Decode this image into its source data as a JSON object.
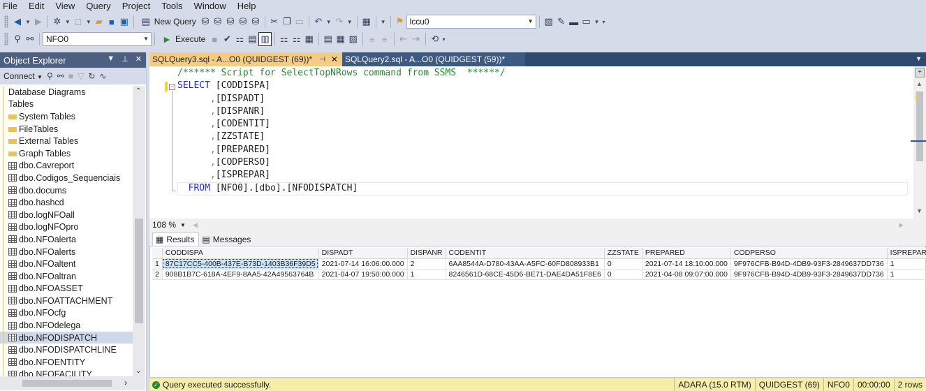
{
  "menu": [
    "File",
    "Edit",
    "View",
    "Query",
    "Project",
    "Tools",
    "Window",
    "Help"
  ],
  "toolbar": {
    "new_query": "New Query",
    "database_combo": "lccu0",
    "execute": "Execute",
    "current_db": "NFO0"
  },
  "object_explorer": {
    "title": "Object Explorer",
    "connect": "Connect",
    "items": [
      {
        "label": "Database Diagrams",
        "icon": "none"
      },
      {
        "label": "Tables",
        "icon": "none"
      },
      {
        "label": "System Tables",
        "icon": "folder"
      },
      {
        "label": "FileTables",
        "icon": "folder"
      },
      {
        "label": "External Tables",
        "icon": "folder"
      },
      {
        "label": "Graph Tables",
        "icon": "folder"
      },
      {
        "label": "dbo.Cavreport",
        "icon": "table"
      },
      {
        "label": "dbo.Codigos_Sequenciais",
        "icon": "table"
      },
      {
        "label": "dbo.docums",
        "icon": "table"
      },
      {
        "label": "dbo.hashcd",
        "icon": "table"
      },
      {
        "label": "dbo.logNFOall",
        "icon": "table"
      },
      {
        "label": "dbo.logNFOpro",
        "icon": "table"
      },
      {
        "label": "dbo.NFOalerta",
        "icon": "table"
      },
      {
        "label": "dbo.NFOalerts",
        "icon": "table"
      },
      {
        "label": "dbo.NFOaltent",
        "icon": "table"
      },
      {
        "label": "dbo.NFOaltran",
        "icon": "table"
      },
      {
        "label": "dbo.NFOASSET",
        "icon": "table"
      },
      {
        "label": "dbo.NFOATTACHMENT",
        "icon": "table"
      },
      {
        "label": "dbo.NFOcfg",
        "icon": "table"
      },
      {
        "label": "dbo.NFOdelega",
        "icon": "table"
      },
      {
        "label": "dbo.NFODISPATCH",
        "icon": "table",
        "selected": true
      },
      {
        "label": "dbo.NFODISPATCHLINE",
        "icon": "table"
      },
      {
        "label": "dbo.NFOENTITY",
        "icon": "table"
      },
      {
        "label": "dbo.NFOFACILITY",
        "icon": "table"
      }
    ]
  },
  "tabs": {
    "active": "SQLQuery3.sql - A...O0 (QUIDGEST (69))*",
    "inactive": "SQLQuery2.sql - A...O0 (QUIDGEST (59))*"
  },
  "editor": {
    "comment": "/****** Script for SelectTopNRows command from SSMS  ******/",
    "select_kw": "SELECT",
    "first_col": "[CODDISPA]",
    "columns": [
      "[DISPADT]",
      "[DISPANR]",
      "[CODENTIT]",
      "[ZZSTATE]",
      "[PREPARED]",
      "[CODPERSO]",
      "[ISPREPAR]"
    ],
    "from_kw": "FROM",
    "from_target": "[NFO0].[dbo].[NFODISPATCH]"
  },
  "zoom": "108 %",
  "results_tabs": {
    "results": "Results",
    "messages": "Messages"
  },
  "grid": {
    "headers": [
      "CODDISPA",
      "DISPADT",
      "DISPANR",
      "CODENTIT",
      "ZZSTATE",
      "PREPARED",
      "CODPERSO",
      "ISPREPAR"
    ],
    "rows": [
      {
        "n": "1",
        "cells": [
          "87C17CC5-400B-437E-B73D-1403B36F39D5",
          "2021-07-14 16:06:00.000",
          "2",
          "6AA8544A-D780-43AA-A5FC-60FD808933B1",
          "0",
          "2021-07-14 18:10:00.000",
          "9F976CFB-B94D-4DB9-93F3-2849637DD736",
          "1"
        ]
      },
      {
        "n": "2",
        "cells": [
          "908B1B7C-618A-4EF9-8AA5-42A49563764B",
          "2021-04-07 19:50:00.000",
          "1",
          "8246561D-68CE-45D6-BE71-DAE4DA51F8E6",
          "0",
          "2021-04-08 09:07:00.000",
          "9F976CFB-B94D-4DB9-93F3-2849637DD736",
          "1"
        ]
      }
    ]
  },
  "status": {
    "message": "Query executed successfully.",
    "server": "ADARA (15.0 RTM)",
    "user": "QUIDGEST (69)",
    "db": "NFO0",
    "time": "00:00:00",
    "rows": "2 rows"
  }
}
